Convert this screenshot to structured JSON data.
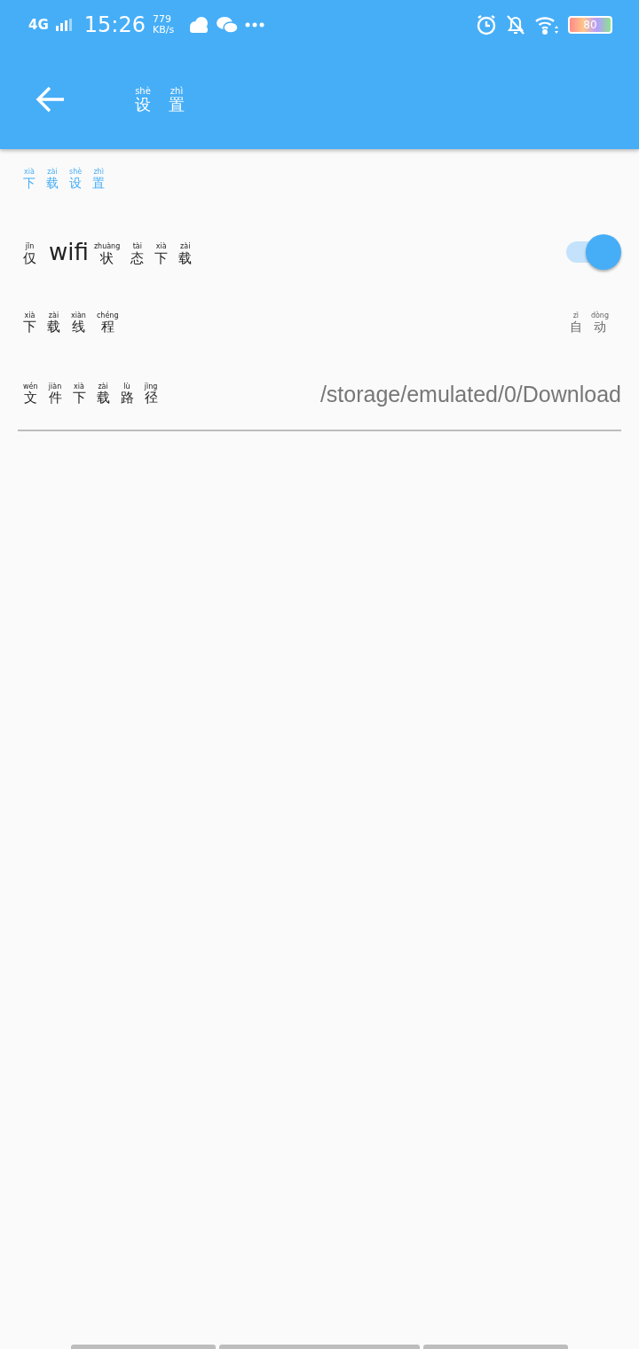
{
  "status_bar": {
    "network": "4G",
    "time": "15:26",
    "speed_value": "779",
    "speed_unit": "KB/s",
    "battery": "80"
  },
  "app_bar": {
    "title": [
      {
        "char": "设",
        "pinyin": "shè"
      },
      {
        "char": "置",
        "pinyin": "zhì"
      }
    ]
  },
  "section_title": [
    {
      "char": "下",
      "pinyin": "xià"
    },
    {
      "char": "载",
      "pinyin": "zài"
    },
    {
      "char": "设",
      "pinyin": "shè"
    },
    {
      "char": "置",
      "pinyin": "zhì"
    }
  ],
  "settings": [
    {
      "kind": "switch",
      "label": [
        {
          "char": "仅",
          "pinyin": "jǐn"
        },
        {
          "text": "wifi"
        },
        {
          "char": "状",
          "pinyin": "zhuàng"
        },
        {
          "char": "态",
          "pinyin": "tài"
        },
        {
          "char": "下",
          "pinyin": "xià"
        },
        {
          "char": "载",
          "pinyin": "zài"
        }
      ],
      "on": true
    },
    {
      "kind": "value",
      "label": [
        {
          "char": "下",
          "pinyin": "xià"
        },
        {
          "char": "载",
          "pinyin": "zài"
        },
        {
          "char": "线",
          "pinyin": "xiàn"
        },
        {
          "char": "程",
          "pinyin": "chéng"
        }
      ],
      "value": [
        {
          "char": "自",
          "pinyin": "zì"
        },
        {
          "char": "动",
          "pinyin": "dòng"
        }
      ]
    },
    {
      "kind": "path",
      "label": [
        {
          "char": "文",
          "pinyin": "wén"
        },
        {
          "char": "件",
          "pinyin": "jiàn"
        },
        {
          "char": "下",
          "pinyin": "xià"
        },
        {
          "char": "载",
          "pinyin": "zài"
        },
        {
          "char": "路",
          "pinyin": "lù"
        },
        {
          "char": "径",
          "pinyin": "jìng"
        }
      ],
      "value": "/storage/emulated/0/Download"
    }
  ]
}
